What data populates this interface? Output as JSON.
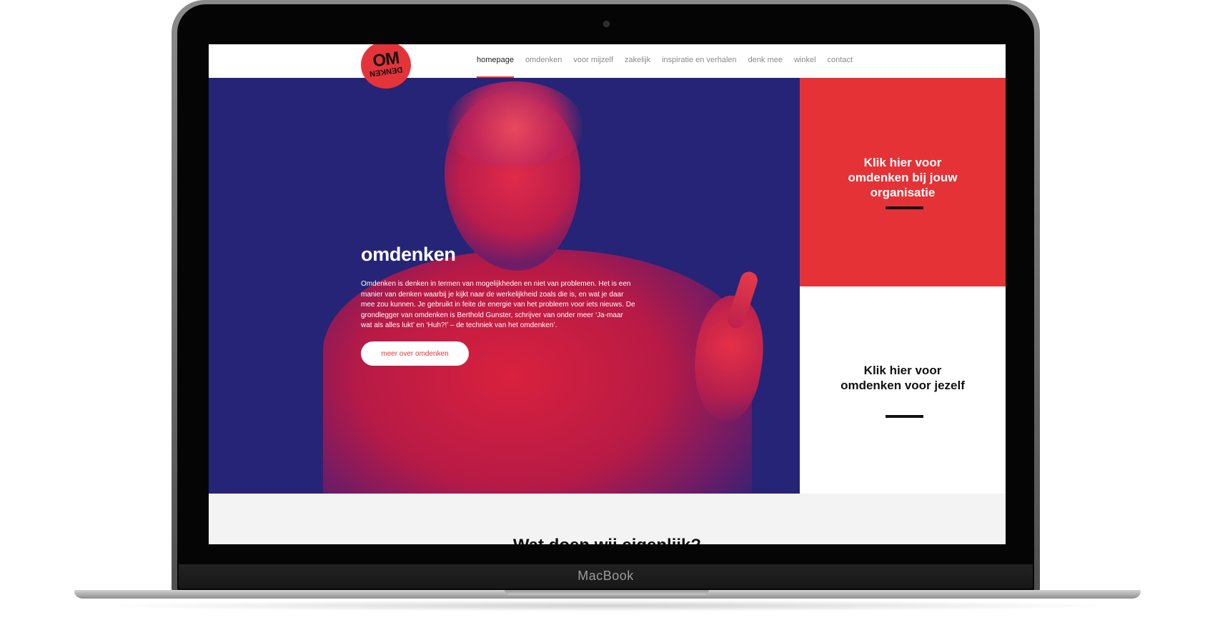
{
  "device": {
    "brand": "MacBook"
  },
  "nav": {
    "logo_top": "OM",
    "logo_bottom": "DENKEN",
    "items": [
      "homepage",
      "omdenken",
      "voor mijzelf",
      "zakelijk",
      "inspiratie en verhalen",
      "denk mee",
      "winkel",
      "contact"
    ],
    "active_index": 0
  },
  "hero": {
    "title": "omdenken",
    "text": "Omdenken is denken in termen van mogelijkheden en niet van problemen. Het is een manier van denken waarbij je kijkt naar de werkelijkheid zoals die is, en wat je daar mee zou kunnen. Je gebruikt in feite de energie van het probleem voor iets nieuws. De grondlegger van omdenken is Berthold Gunster, schrijver van onder meer ‘Ja-maar wat als alles lukt’ en ‘Huh?!’ – de techniek van het omdenken’.",
    "button_label": "meer over omdenken"
  },
  "panels": {
    "organisatie": "Klik hier voor omdenken bij jouw organisatie",
    "jezelf": "Klik hier voor omdenken voor jezelf"
  },
  "lower": {
    "heading": "Wat doen wij eigenlijk?"
  },
  "colors": {
    "brand_red": "#e4343a",
    "hero_blue": "#252477",
    "text_dark": "#111111"
  }
}
